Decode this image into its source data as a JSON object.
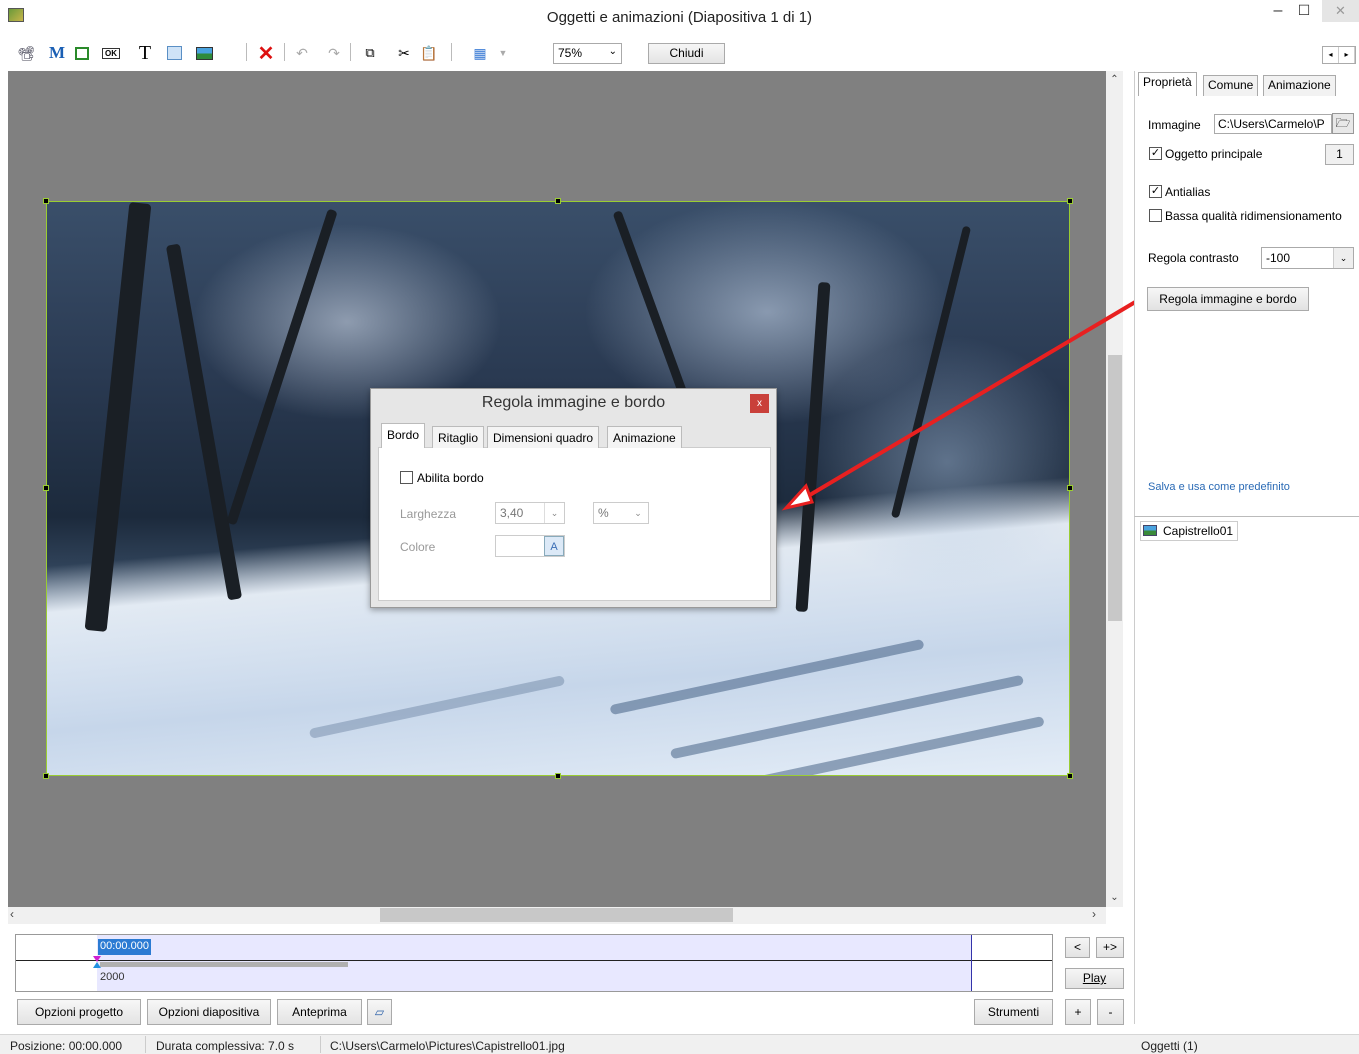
{
  "window": {
    "title": "Oggetti e animazioni  (Diapositiva 1 di 1)",
    "min": "–",
    "max": "☐",
    "close": "✕"
  },
  "toolbar": {
    "zoom_value": "75%",
    "close_label": "Chiudi",
    "icons": [
      "camera-icon",
      "mask-icon",
      "frame-icon",
      "button-icon",
      "text-icon",
      "rectangle-icon",
      "image-icon",
      "delete-icon",
      "undo-icon",
      "redo-icon",
      "copy-icon",
      "cut-icon",
      "paste-icon",
      "grid-icon"
    ]
  },
  "dialog": {
    "title": "Regola immagine e bordo",
    "close": "x",
    "tabs": [
      "Bordo",
      "Ritaglio",
      "Dimensioni quadro",
      "Animazione"
    ],
    "enable_border_label": "Abilita bordo",
    "enable_border_checked": false,
    "width_label": "Larghezza",
    "width_value": "3,40",
    "unit_value": "%",
    "color_label": "Colore",
    "color_btn": "A"
  },
  "properties": {
    "tabs": [
      "Proprietà",
      "Comune",
      "Animazione"
    ],
    "image_label": "Immagine",
    "image_path": "C:\\Users\\Carmelo\\P",
    "main_object_label": "Oggetto principale",
    "main_object_checked": true,
    "main_object_num": "1",
    "antialias_label": "Antialias",
    "antialias_checked": true,
    "low_quality_label": "Bassa qualità ridimensionamento",
    "low_quality_checked": false,
    "contrast_label": "Regola contrasto",
    "contrast_value": "-100",
    "adjust_button": "Regola immagine e bordo",
    "save_default": "Salva e usa come predefinito"
  },
  "objects": {
    "items": [
      "Capistrello01"
    ],
    "count_label": "Oggetti (1)"
  },
  "timeline": {
    "time": "00:00.000",
    "duration": "2000",
    "prev": "<",
    "next": "+>",
    "play": "Play",
    "plus": "+",
    "minus": "-"
  },
  "bottom": {
    "project_options": "Opzioni progetto",
    "slide_options": "Opzioni diapositiva",
    "preview": "Anteprima",
    "tools": "Strumenti"
  },
  "status": {
    "position": "Posizione:  00:00.000",
    "duration": "Durata complessiva:  7.0 s",
    "file": "C:\\Users\\Carmelo\\Pictures\\Capistrello01.jpg"
  },
  "colors": {
    "canvas_bg": "#808080",
    "selection": "#9acd32",
    "arrow": "#e82020",
    "link": "#2a6ab5"
  }
}
